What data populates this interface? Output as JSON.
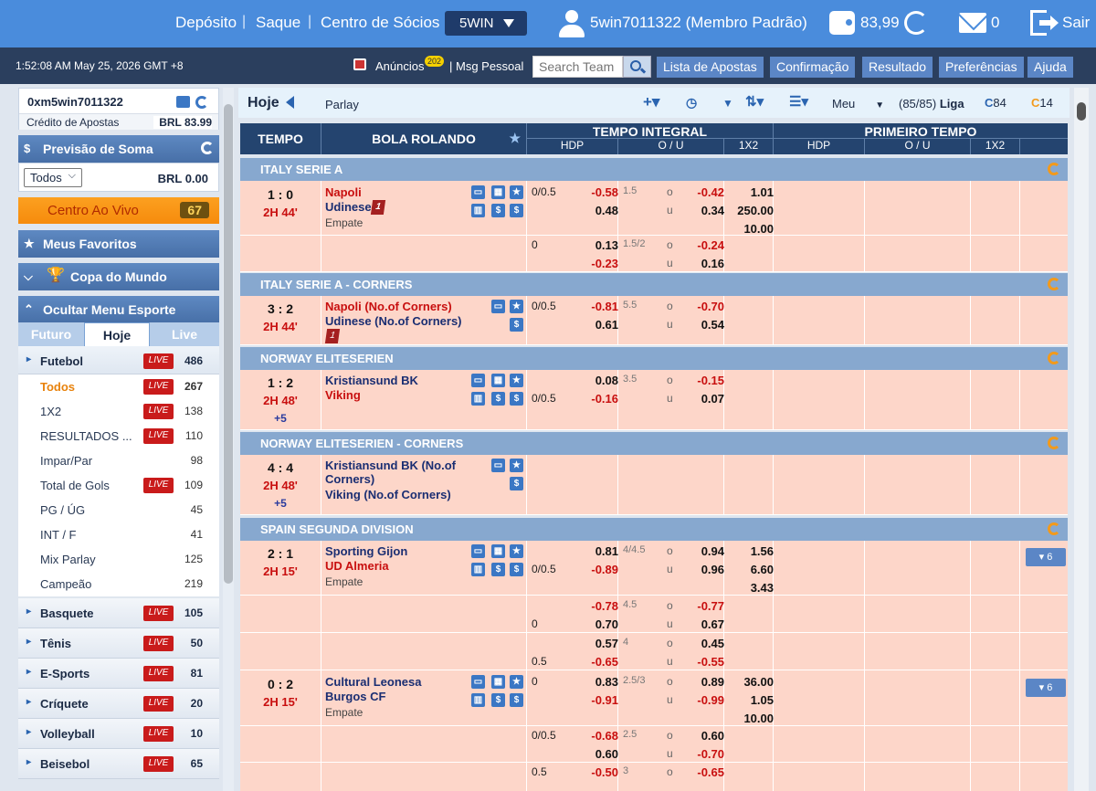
{
  "top": {
    "deposit": "Depósito",
    "withdraw": "Saque",
    "members": "Centro de Sócios",
    "brand": "5WIN",
    "user": "5win7011322 (Membro Padrão)",
    "balance": "83,99",
    "messages": "0",
    "logout": "Sair"
  },
  "sub": {
    "clock": "1:52:08 AM May 25, 2026 GMT +8",
    "announcements": "Anúncios",
    "badge": "202",
    "private_msg": "| Msg Pessoal",
    "search_placeholder": "Search Team",
    "bets_list": "Lista de Apostas",
    "confirmation": "Confirmação",
    "result": "Resultado",
    "preferences": "Preferências",
    "help": "Ajuda"
  },
  "account": {
    "username": "0xm5win7011322",
    "credit_label": "Crédito de Apostas",
    "credit_value": "BRL  83.99"
  },
  "sum": {
    "title": "Previsão de Soma",
    "select": "Todos",
    "value": "BRL 0.00"
  },
  "live_center": {
    "label": "Centro Ao Vivo",
    "count": "67"
  },
  "favorites": "Meus Favoritos",
  "worldcup": "Copa do Mundo",
  "hide_menu": "Ocultar Menu Esporte",
  "tabs": [
    "Futuro",
    "Hoje",
    "Live"
  ],
  "live_badge": "LIVE",
  "futebol": {
    "label": "Futebol",
    "count": "486"
  },
  "submenu": [
    {
      "label": "Todos",
      "count": "267",
      "live": true,
      "active": true
    },
    {
      "label": "1X2",
      "count": "138",
      "live": true
    },
    {
      "label": "RESULTADOS ...",
      "count": "110",
      "live": true
    },
    {
      "label": "Impar/Par",
      "count": "98",
      "live": false
    },
    {
      "label": "Total de Gols",
      "count": "109",
      "live": true
    },
    {
      "label": "PG / ÚG",
      "count": "45",
      "live": false
    },
    {
      "label": "INT / F",
      "count": "41",
      "live": false
    },
    {
      "label": "Mix Parlay",
      "count": "125",
      "live": false
    },
    {
      "label": "Campeão",
      "count": "219",
      "live": false
    }
  ],
  "sports": [
    {
      "label": "Basquete",
      "count": "105"
    },
    {
      "label": "Tênis",
      "count": "50"
    },
    {
      "label": "E-Sports",
      "count": "81"
    },
    {
      "label": "Críquete",
      "count": "20"
    },
    {
      "label": "Volleyball",
      "count": "10"
    },
    {
      "label": "Beisebol",
      "count": "65"
    }
  ],
  "main": {
    "title": "Hoje",
    "parlay": "Parlay",
    "meu": "Meu",
    "liga_count": "(85/85)",
    "liga": "Liga",
    "refresh_a": "84",
    "refresh_b": "14"
  },
  "thead": {
    "tempo": "TEMPO",
    "bola": "BOLA ROLANDO",
    "integral": "TEMPO INTEGRAL",
    "primeiro": "PRIMEIRO TEMPO",
    "hdp": "HDP",
    "ou": "O / U",
    "x12": "1X2"
  },
  "leagues": [
    "ITALY SERIE A",
    "ITALY SERIE A - CORNERS",
    "NORWAY ELITESERIEN",
    "NORWAY ELITESERIEN - CORNERS",
    "SPAIN SEGUNDA DIVISION"
  ],
  "m1": {
    "score": "1 : 0",
    "time": "2H 44'",
    "home": "Napoli",
    "away": "Udinese",
    "red": "1",
    "draw": "Empate",
    "r1_hdp": "0/0.5",
    "r1_h": "-0.58",
    "r1_a": "0.48",
    "r1_ou": "1.5",
    "r1_o": "-0.42",
    "r1_u": "0.34",
    "x1": "1.01",
    "x2": "250.00",
    "xx": "10.00",
    "r2_hdp": "0",
    "r2_h": "0.13",
    "r2_a": "-0.23",
    "r2_ou": "1.5/2",
    "r2_o": "-0.24",
    "r2_u": "0.16"
  },
  "m2": {
    "score": "3 : 2",
    "time": "2H 44'",
    "home": "Napoli (No.of Corners)",
    "away": "Udinese (No.of Corners)",
    "red": "1",
    "hdp": "0/0.5",
    "h": "-0.81",
    "a": "0.61",
    "ou": "5.5",
    "o": "-0.70",
    "u": "0.54"
  },
  "m3": {
    "score": "1 : 2",
    "time": "2H 48'",
    "plus": "+5",
    "home": "Kristiansund BK",
    "away": "Viking",
    "h": "0.08",
    "hdp": "0/0.5",
    "a": "-0.16",
    "ou": "3.5",
    "o": "-0.15",
    "u": "0.07"
  },
  "m4": {
    "score": "4 : 4",
    "time": "2H 48'",
    "plus": "+5",
    "home": "Kristiansund BK (No.of Corners)",
    "away": "Viking (No.of Corners)"
  },
  "m5": {
    "score": "2 : 1",
    "time": "2H 15'",
    "home": "Sporting Gijon",
    "away": "UD Almeria",
    "draw": "Empate",
    "more": "▾ 6",
    "r1_h": "0.81",
    "r1_hdp": "0/0.5",
    "r1_a": "-0.89",
    "r1_ou": "4/4.5",
    "r1_o": "0.94",
    "r1_u": "0.96",
    "x1": "1.56",
    "x2": "6.60",
    "xx": "3.43",
    "r2_h": "-0.78",
    "r2_hdp": "0",
    "r2_a": "0.70",
    "r2_ou": "4.5",
    "r2_o": "-0.77",
    "r2_u": "0.67",
    "r3_h": "0.57",
    "r3_hdp": "0.5",
    "r3_a": "-0.65",
    "r3_ou": "4",
    "r3_o": "0.45",
    "r3_u": "-0.55"
  },
  "m6": {
    "score": "0 : 2",
    "time": "2H 15'",
    "home": "Cultural Leonesa",
    "away": "Burgos CF",
    "draw": "Empate",
    "more": "▾ 6",
    "r1_hdp": "0",
    "r1_h": "0.83",
    "r1_a": "-0.91",
    "r1_ou": "2.5/3",
    "r1_o": "0.89",
    "r1_u": "-0.99",
    "x1": "36.00",
    "x2": "1.05",
    "xx": "10.00",
    "r2_hdp": "0/0.5",
    "r2_h": "-0.68",
    "r2_a": "0.60",
    "r2_ou": "2.5",
    "r2_o": "0.60",
    "r2_u": "-0.70",
    "r3_hdp": "0.5",
    "r3_h": "-0.50",
    "r3_ou": "3",
    "r3_o": "-0.65"
  },
  "ou_labels": {
    "o": "o",
    "u": "u"
  }
}
